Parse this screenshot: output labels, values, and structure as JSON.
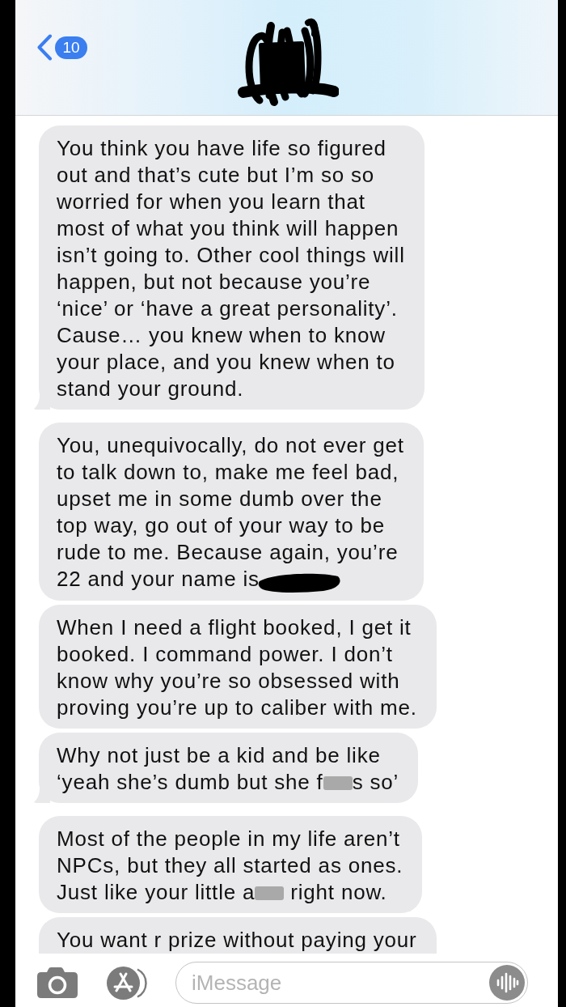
{
  "header": {
    "unread_count": "10"
  },
  "messages": [
    {
      "tail": true,
      "parts": [
        {
          "kind": "text",
          "text": "You think you have life so figured\nout and that’s cute but I’m so so\nworried for when you learn that\nmost of what you think will happen\nisn’t going to. Other cool things will\nhappen, but not because you’re\n‘nice’ or ‘have a great personality’.\nCause… you knew when to know\nyour place, and you knew when to\nstand your ground."
        }
      ]
    },
    {
      "tail": false,
      "parts": [
        {
          "kind": "text",
          "text": "You, unequivocally, do not ever get\nto talk down to, make me feel bad,\nupset me in some dumb over the\ntop way, go out of your way to be\nrude to me. Because again, you’re"
        },
        {
          "kind": "line",
          "parts": [
            {
              "kind": "text",
              "text": "22 and your name is"
            },
            {
              "kind": "scribble"
            }
          ]
        }
      ]
    },
    {
      "tail": false,
      "parts": [
        {
          "kind": "text",
          "text": "When I need a flight booked, I get it\nbooked. I command power. I don’t\nknow why you’re so obsessed with\nproving you’re up to caliber with me."
        }
      ]
    },
    {
      "tail": true,
      "parts": [
        {
          "kind": "text",
          "text": "Why not just be a kid and be like"
        },
        {
          "kind": "line",
          "parts": [
            {
              "kind": "text",
              "text": "‘yeah she’s dumb but she f"
            },
            {
              "kind": "blur"
            },
            {
              "kind": "text",
              "text": "s so’"
            }
          ]
        }
      ]
    },
    {
      "tail": false,
      "parts": [
        {
          "kind": "text",
          "text": "Most of the people in my life aren’t\nNPCs, but they all started as ones."
        },
        {
          "kind": "line",
          "parts": [
            {
              "kind": "text",
              "text": "Just like your little a"
            },
            {
              "kind": "blur"
            },
            {
              "kind": "text",
              "text": " right now."
            }
          ]
        }
      ]
    },
    {
      "tail": false,
      "parts": [
        {
          "kind": "text",
          "text": "You want r prize without paying your"
        }
      ]
    }
  ],
  "composer": {
    "placeholder": "iMessage"
  }
}
